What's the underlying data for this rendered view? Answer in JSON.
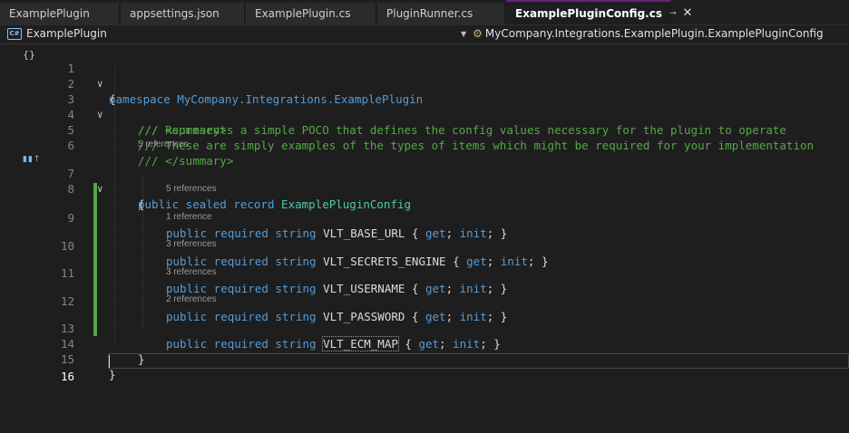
{
  "tabs": [
    {
      "label": "ExamplePlugin"
    },
    {
      "label": "appsettings.json"
    },
    {
      "label": "ExamplePlugin.cs"
    },
    {
      "label": "PluginRunner.cs"
    },
    {
      "label": "ExamplePluginConfig.cs",
      "pin": "⊸",
      "close": "✕"
    }
  ],
  "navbar": {
    "project": "ExamplePlugin",
    "project_icon": "C#",
    "member": "MyCompany.Integrations.ExamplePlugin.ExamplePluginConfig"
  },
  "editor": {
    "lines": [
      {
        "n": "1",
        "text": "namespace MyCompany.Integrations.ExamplePlugin"
      },
      {
        "n": "2",
        "text": "{"
      },
      {
        "n": "3",
        "text": "/// <summary>"
      },
      {
        "n": "4",
        "text": "/// Represents a simple POCO that defines the config values necessary for the plugin to operate"
      },
      {
        "n": "5",
        "text": "/// These are simply examples of the types of items which might be required for your implementation"
      },
      {
        "n": "6",
        "text": "/// </summary>"
      },
      {
        "n": "7",
        "text": "public sealed record ExamplePluginConfig"
      },
      {
        "n": "8",
        "text": "{"
      },
      {
        "n": "9",
        "text": "public required string VLT_BASE_URL { get; init; }"
      },
      {
        "n": "10",
        "text": "public required string VLT_SECRETS_ENGINE { get; init; }"
      },
      {
        "n": "11",
        "text": "public required string VLT_USERNAME { get; init; }"
      },
      {
        "n": "12",
        "text": "public required string VLT_PASSWORD { get; init; }"
      },
      {
        "n": "13",
        "text": "public required string VLT_ECM_MAP { get; init; }"
      },
      {
        "n": "14",
        "text": "}"
      },
      {
        "n": "15",
        "text": "}"
      },
      {
        "n": "16",
        "text": ""
      }
    ],
    "references": {
      "record": "5 references",
      "base_url": "5 references",
      "secrets_engine": "1 reference",
      "username": "3 references",
      "password": "3 references",
      "ecm_map": "2 references"
    }
  },
  "colors": {
    "keyword": "#569cd6",
    "type": "#4ec9b0",
    "comment": "#57a64a",
    "change_bar": "#57a64a",
    "active_tab_accent": "#68217a"
  }
}
